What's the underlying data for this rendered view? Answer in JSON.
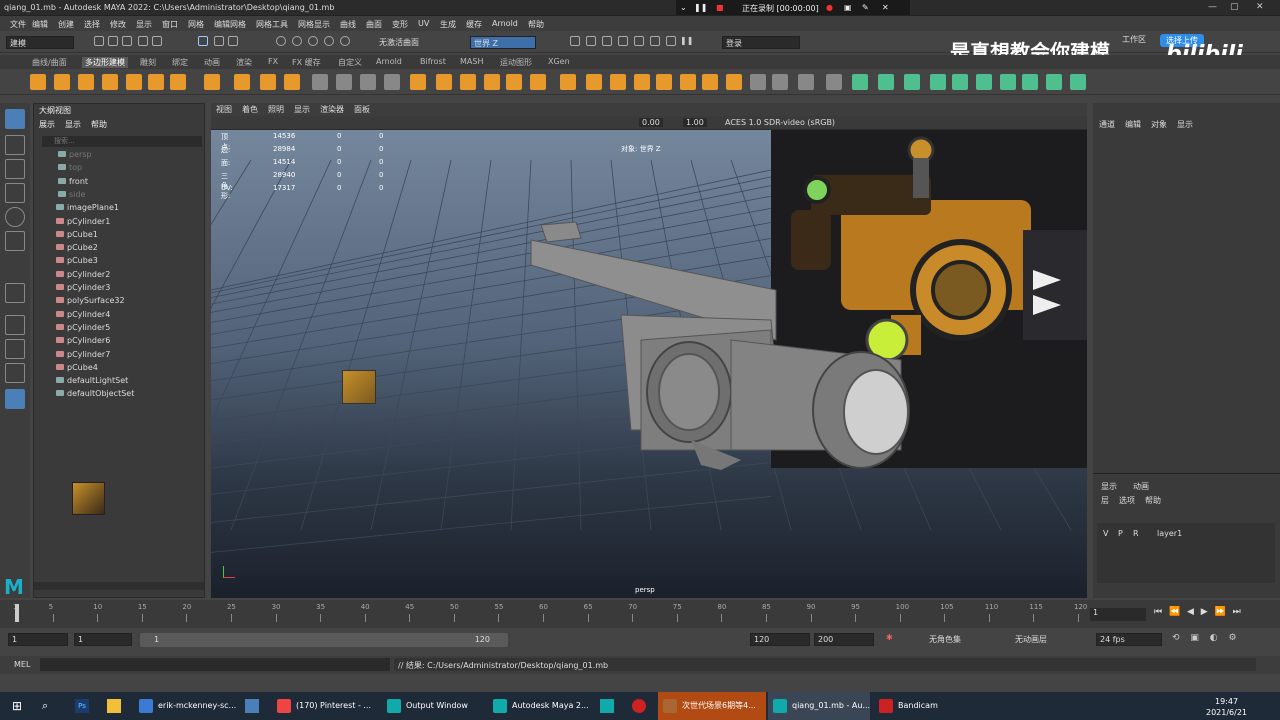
{
  "titlebar": {
    "title": "qiang_01.mb - Autodesk MAYA 2022: C:\\Users\\Administrator\\Desktop\\qiang_01.mb",
    "recording": "正在录制 [00:00:00]"
  },
  "menu": [
    "文件",
    "编辑",
    "创建",
    "选择",
    "修改",
    "显示",
    "窗口",
    "网格",
    "编辑网格",
    "网格工具",
    "网格显示",
    "曲线",
    "曲面",
    "变形",
    "UV",
    "生成",
    "缓存",
    "Arnold",
    "帮助"
  ],
  "status": {
    "mode": "建模",
    "live_surface": "无激活曲面",
    "axis": "世界 Z",
    "login": "登录",
    "workspace": "工作区",
    "upload": "选择上传"
  },
  "watermark": "是真想教会你建模",
  "shelf_tabs": [
    "曲线/曲面",
    "多边形建模",
    "雕刻",
    "绑定",
    "动画",
    "渲染",
    "FX",
    "FX 缓存",
    "自定义",
    "Arnold",
    "Bifrost",
    "MASH",
    "运动图形",
    "XGen"
  ],
  "shelf_active": "多边形建模",
  "outliner": {
    "title": "大纲视图",
    "menu": [
      "展示",
      "显示",
      "帮助"
    ],
    "search_placeholder": "搜索...",
    "items": [
      {
        "label": "persp",
        "dim": true
      },
      {
        "label": "top",
        "dim": true
      },
      {
        "label": "front",
        "dim": false
      },
      {
        "label": "side",
        "dim": true
      },
      {
        "label": "imagePlane1"
      },
      {
        "label": "pCylinder1"
      },
      {
        "label": "pCube1"
      },
      {
        "label": "pCube2"
      },
      {
        "label": "pCube3"
      },
      {
        "label": "pCylinder2"
      },
      {
        "label": "pCylinder3"
      },
      {
        "label": "polySurface32"
      },
      {
        "label": "pCylinder4"
      },
      {
        "label": "pCylinder5"
      },
      {
        "label": "pCylinder6"
      },
      {
        "label": "pCylinder7"
      },
      {
        "label": "pCube4"
      },
      {
        "label": "defaultLightSet"
      },
      {
        "label": "defaultObjectSet"
      }
    ]
  },
  "viewport": {
    "menu": [
      "视图",
      "着色",
      "照明",
      "显示",
      "渲染器",
      "面板"
    ],
    "exposure": "0.00",
    "gamma": "1.00",
    "colorspace": "ACES 1.0 SDR-video (sRGB)",
    "camera": "persp",
    "object_label": "对象: 世界 Z",
    "hud": [
      {
        "name": "顶点:",
        "a": "14536",
        "b": "0",
        "c": "0"
      },
      {
        "name": "边:",
        "a": "28984",
        "b": "0",
        "c": "0"
      },
      {
        "name": "面:",
        "a": "14514",
        "b": "0",
        "c": "0"
      },
      {
        "name": "三角形:",
        "a": "28940",
        "b": "0",
        "c": "0"
      },
      {
        "name": "UV:",
        "a": "17317",
        "b": "0",
        "c": "0"
      }
    ]
  },
  "right_panel": {
    "menu": [
      "通道",
      "编辑",
      "对象",
      "显示"
    ],
    "tabs": [
      "显示",
      "动画"
    ],
    "layer_menu": [
      "层",
      "选项",
      "帮助"
    ],
    "layer_cols": [
      "V",
      "P",
      "R"
    ],
    "layer_name": "layer1"
  },
  "timeline": {
    "ticks": [
      "1",
      "5",
      "10",
      "15",
      "20",
      "25",
      "30",
      "35",
      "40",
      "45",
      "50",
      "55",
      "60",
      "65",
      "70",
      "75",
      "80",
      "85",
      "90",
      "95",
      "100",
      "105",
      "110",
      "115",
      "120"
    ],
    "current": "1"
  },
  "range": {
    "start": "1",
    "start2": "1",
    "slider_start": "1",
    "slider_end": "120",
    "end": "120",
    "end2": "200",
    "char_set": "无角色集",
    "anim_layer": "无动画层",
    "fps": "24 fps"
  },
  "mel": {
    "label": "MEL",
    "result": "// 结果: C:/Users/Administrator/Desktop/qiang_01.mb"
  },
  "taskbar": {
    "items": [
      {
        "label": "erik-mckenney-sc...",
        "color": "#3a7bd5"
      },
      {
        "label": "(170) Pinterest - ...",
        "color": "#e44"
      },
      {
        "label": "Output Window",
        "color": "#1aa"
      },
      {
        "label": "Autodesk Maya 2...",
        "color": "#1aa"
      },
      {
        "label": "次世代场景6期等4...",
        "color": "#a63"
      },
      {
        "label": "qiang_01.mb - Au...",
        "color": "#1aa"
      },
      {
        "label": "Bandicam",
        "color": "#c22"
      }
    ],
    "time": "19:47",
    "date": "2021/6/21"
  }
}
